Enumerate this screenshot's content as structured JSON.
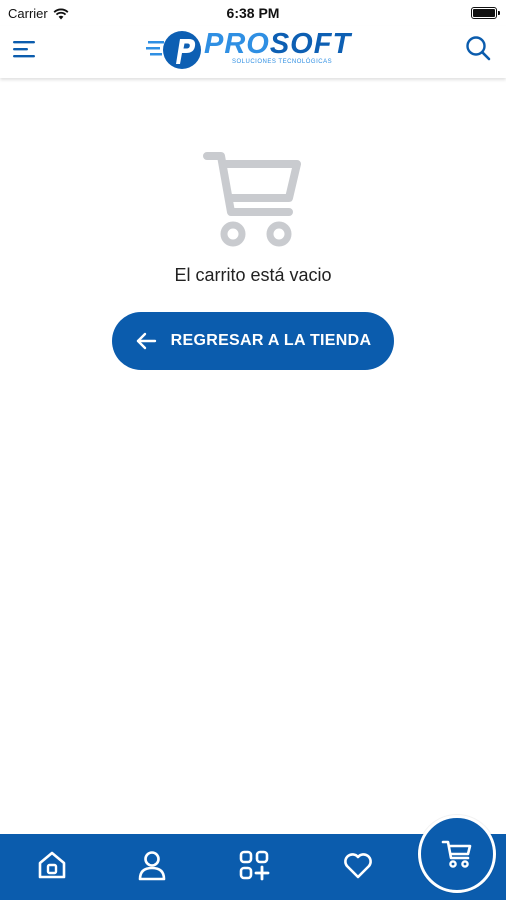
{
  "status_bar": {
    "carrier": "Carrier",
    "time": "6:38 PM"
  },
  "header": {
    "logo_text_a": "PRO",
    "logo_text_b": "SOFT",
    "logo_tagline": "SOLUCIONES TECNOLÓGICAS"
  },
  "main": {
    "empty_message": "El carrito está vacio",
    "back_button_label": "REGRESAR A LA TIENDA"
  },
  "bottom_nav": {
    "items": [
      {
        "icon": "home-icon"
      },
      {
        "icon": "user-icon"
      },
      {
        "icon": "categories-icon"
      },
      {
        "icon": "heart-icon"
      }
    ],
    "fab_icon": "cart-icon"
  },
  "colors": {
    "primary": "#0b5cad",
    "logo_light": "#2f8fe3",
    "illustration_gray": "#c9cbcf"
  }
}
